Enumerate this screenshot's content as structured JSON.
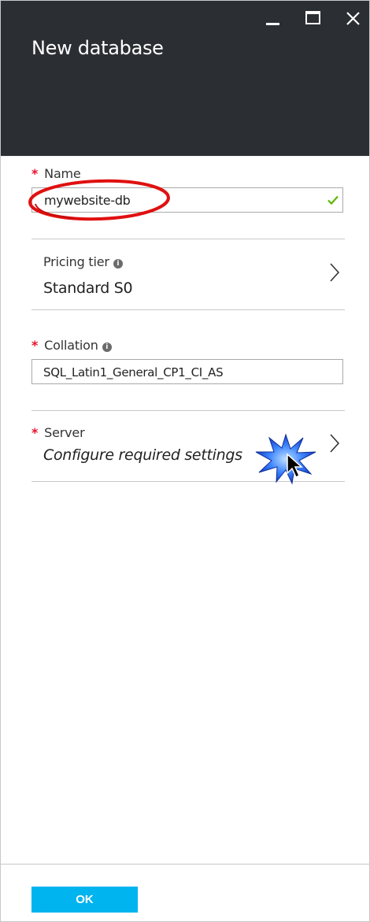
{
  "window": {
    "title": "New database",
    "controls": [
      "minimize-icon",
      "maximize-icon",
      "close-icon"
    ]
  },
  "form": {
    "name": {
      "label": "Name",
      "required": "*",
      "value": "mywebsite-db",
      "status_icon": "checkmark-icon"
    },
    "pricing_tier": {
      "label": "Pricing tier",
      "info_icon": "i",
      "value": "Standard S0",
      "icon": "chevron-right-icon"
    },
    "collation": {
      "label": "Collation",
      "required": "*",
      "info_icon": "i",
      "value": "SQL_Latin1_General_CP1_CI_AS"
    },
    "server": {
      "label": "Server",
      "required": "*",
      "value": "Configure required settings",
      "icon": "chevron-right-icon"
    }
  },
  "footer": {
    "ok_label": "OK"
  },
  "colors": {
    "header_bg": "#2b2e33",
    "accent": "#00b4ef",
    "required": "#e8112d",
    "valid": "#5cb800",
    "annotation_oval": "#e01010",
    "cursor_burst": "#1f63e8"
  }
}
